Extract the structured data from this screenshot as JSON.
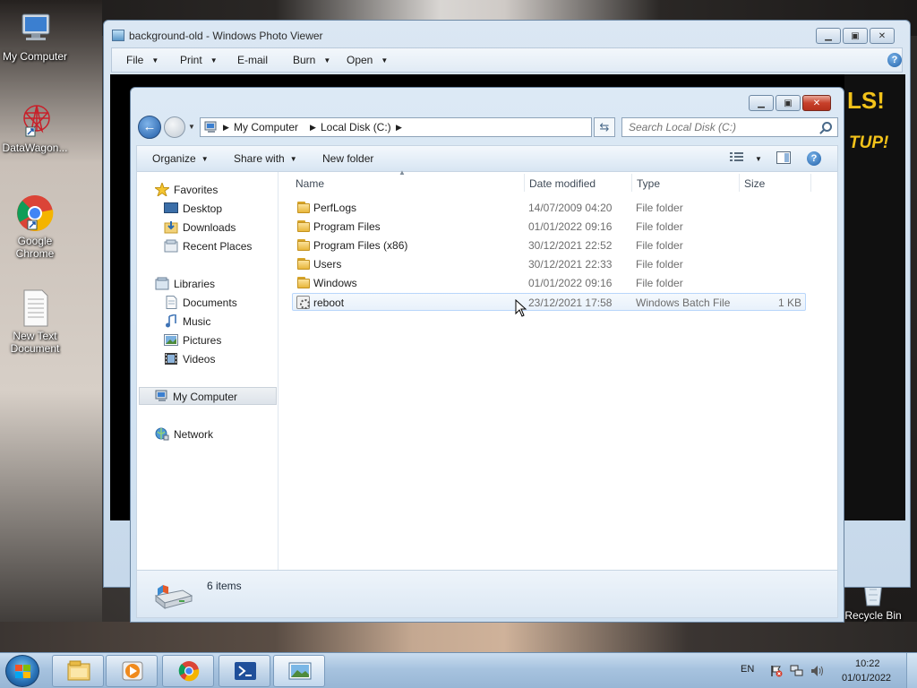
{
  "desktop": {
    "icons": [
      {
        "label": "My Computer"
      },
      {
        "label": "DataWagon..."
      },
      {
        "label": "Google Chrome"
      },
      {
        "label": "New Text Document"
      },
      {
        "label": "Recycle Bin"
      }
    ]
  },
  "photo_viewer": {
    "title": "background-old - Windows Photo Viewer",
    "menu": [
      {
        "label": "File",
        "has_dropdown": true
      },
      {
        "label": "Print",
        "has_dropdown": true
      },
      {
        "label": "E-mail",
        "has_dropdown": false
      },
      {
        "label": "Burn",
        "has_dropdown": true
      },
      {
        "label": "Open",
        "has_dropdown": true
      }
    ],
    "image_text_1": "LS!",
    "image_text_2": "TUP!"
  },
  "explorer": {
    "breadcrumb": [
      "My Computer",
      "Local Disk (C:)"
    ],
    "search_placeholder": "Search Local Disk (C:)",
    "commands": {
      "organize": "Organize",
      "share_with": "Share with",
      "new_folder": "New folder"
    },
    "nav": {
      "favorites": "Favorites",
      "favorites_items": [
        "Desktop",
        "Downloads",
        "Recent Places"
      ],
      "libraries": "Libraries",
      "libraries_items": [
        "Documents",
        "Music",
        "Pictures",
        "Videos"
      ],
      "computer": "My Computer",
      "network": "Network"
    },
    "columns": [
      "Name",
      "Date modified",
      "Type",
      "Size"
    ],
    "rows": [
      {
        "name": "PerfLogs",
        "date": "14/07/2009 04:20",
        "type": "File folder",
        "size": "",
        "icon": "folder-icon"
      },
      {
        "name": "Program Files",
        "date": "01/01/2022 09:16",
        "type": "File folder",
        "size": "",
        "icon": "folder-icon"
      },
      {
        "name": "Program Files (x86)",
        "date": "30/12/2021 22:52",
        "type": "File folder",
        "size": "",
        "icon": "folder-icon"
      },
      {
        "name": "Users",
        "date": "30/12/2021 22:33",
        "type": "File folder",
        "size": "",
        "icon": "folder-icon"
      },
      {
        "name": "Windows",
        "date": "01/01/2022 09:16",
        "type": "File folder",
        "size": "",
        "icon": "folder-icon"
      },
      {
        "name": "reboot",
        "date": "23/12/2021 17:58",
        "type": "Windows Batch File",
        "size": "1 KB",
        "icon": "batch-file-icon"
      }
    ],
    "status": "6 items"
  },
  "taskbar": {
    "language": "EN",
    "time": "10:22",
    "date": "01/01/2022"
  },
  "colors": {
    "accent": "#1f5ba6",
    "selection_border": "#b8d6fb",
    "close_button": "#c7402a"
  }
}
